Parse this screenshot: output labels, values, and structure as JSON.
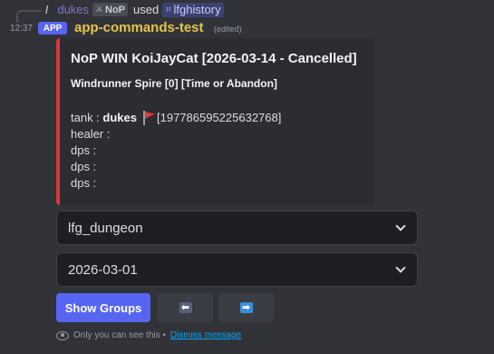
{
  "reply": {
    "slash": "/",
    "user": "dukes",
    "guild_tag": "NoP",
    "guild_tag_icon": "sword-icon",
    "used_text": "used",
    "command": "lfghistory",
    "command_icon": "slash-command-icon"
  },
  "message": {
    "timestamp": "12:37",
    "badge": "APP",
    "app_name": "app-commands-test",
    "edited": "(edited)"
  },
  "embed": {
    "accent_color": "#da373c",
    "title": "NoP WIN KoiJayCat [2026-03-14 - Cancelled]",
    "subtitle": "Windrunner Spire [0] [Time or Abandon]",
    "tank_label": "tank :",
    "tank_name": "dukes",
    "tank_flag_icon": "red-flag-icon",
    "tank_id": "[197786595225632768]",
    "healer_label": "healer :",
    "dps_lines": [
      "dps :",
      "dps :",
      "dps :"
    ]
  },
  "selects": {
    "dungeon": "lfg_dungeon",
    "date": "2026-03-01"
  },
  "buttons": {
    "show_groups": "Show Groups",
    "prev": "⬅",
    "next": "➡"
  },
  "ephemeral": {
    "text": "Only you can see this •",
    "dismiss": "Dismiss message"
  },
  "colors": {
    "background": "#323339",
    "embed_bg": "#2b2d31",
    "primary": "#5865f2",
    "app_name": "#e3c64a",
    "link": "#00a8fc"
  }
}
